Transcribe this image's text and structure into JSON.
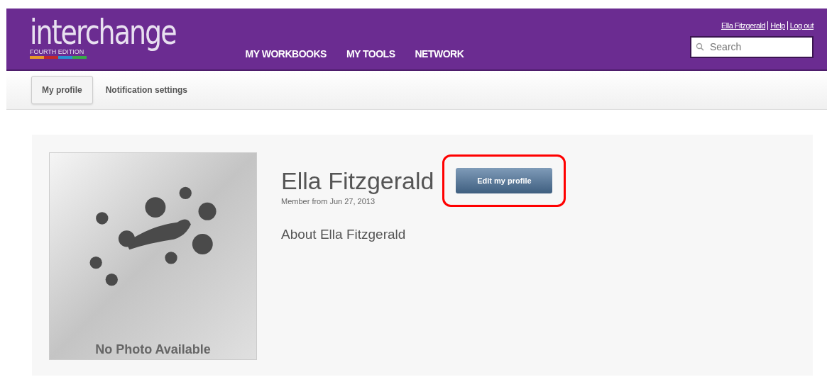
{
  "header": {
    "logo": {
      "name": "interchange",
      "edition": "FOURTH EDITION"
    },
    "nav": [
      {
        "label": "MY WORKBOOKS"
      },
      {
        "label": "MY TOOLS"
      },
      {
        "label": "NETWORK"
      }
    ],
    "user_links": [
      "Ella Fitzgerald",
      "Help",
      "Log out"
    ],
    "search": {
      "placeholder": "Search"
    }
  },
  "tabs": [
    {
      "label": "My profile",
      "selected": true
    },
    {
      "label": "Notification settings",
      "selected": false
    }
  ],
  "profile": {
    "photo_caption": "No Photo Available",
    "name": "Ella Fitzgerald",
    "member_since": "Member from Jun 27, 2013",
    "edit_button": {
      "label": "Edit my profile",
      "highlighted": true
    },
    "about_heading": "About Ella Fitzgerald"
  }
}
